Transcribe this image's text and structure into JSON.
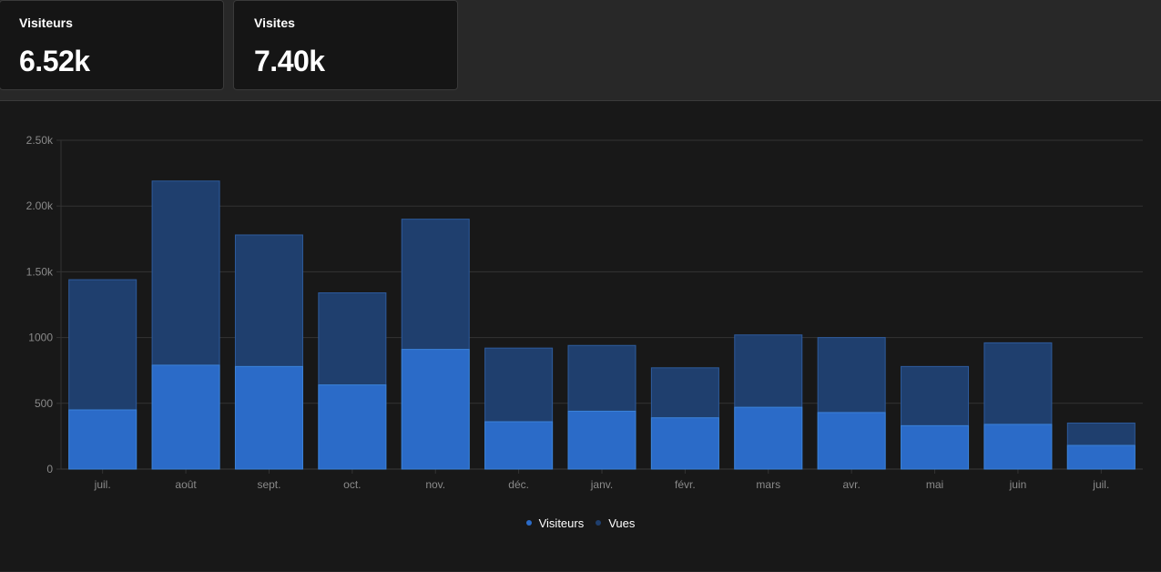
{
  "metrics": {
    "visitors_label": "Visiteurs",
    "visitors_value": "6.52k",
    "visits_label": "Visites",
    "visits_value": "7.40k"
  },
  "colors": {
    "visitors": "#2b6bc8",
    "views": "#1f3f6e",
    "grid": "#333333",
    "axis_text": "#8a8a8a"
  },
  "chart_data": {
    "type": "bar",
    "categories": [
      "juil.",
      "août",
      "sept.",
      "oct.",
      "nov.",
      "déc.",
      "janv.",
      "févr.",
      "mars",
      "avr.",
      "mai",
      "juin",
      "juil."
    ],
    "series": [
      {
        "name": "Visiteurs",
        "values": [
          450,
          790,
          780,
          640,
          910,
          360,
          440,
          390,
          470,
          430,
          330,
          340,
          180
        ]
      },
      {
        "name": "Vues",
        "values": [
          1440,
          2190,
          1780,
          1340,
          1900,
          920,
          940,
          770,
          1020,
          1000,
          780,
          960,
          350
        ]
      }
    ],
    "y_ticks": [
      "0",
      "500",
      "1000",
      "1.50k",
      "2.00k",
      "2.50k"
    ],
    "ylim": [
      0,
      2500
    ],
    "grid": true,
    "legend_position": "bottom-center",
    "bars_overlap": true
  }
}
